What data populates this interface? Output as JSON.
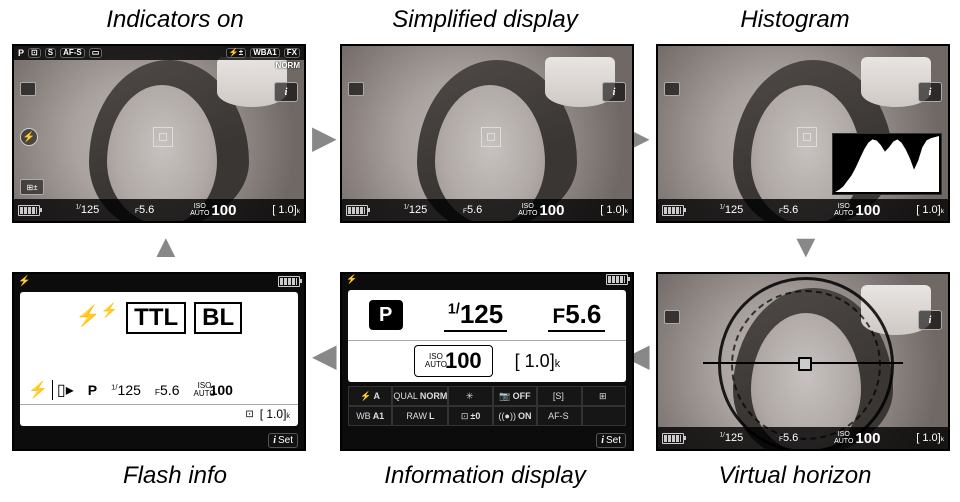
{
  "labels": {
    "indicators_on": "Indicators on",
    "simplified": "Simplified display",
    "histogram": "Histogram",
    "flash": "Flash info",
    "info": "Information display",
    "virtual": "Virtual horizon"
  },
  "common": {
    "mode": "P",
    "shutter_pre": "1/",
    "shutter_val": "125",
    "aperture_pre": "F",
    "aperture_val": "5.6",
    "iso_label_top": "ISO",
    "iso_label_bot": "AUTO",
    "iso_val": "100",
    "remaining": "[  1.0]",
    "remaining_suffix": "k",
    "i_icon": "i",
    "set_label": "Set",
    "flash_glyph": "⚡",
    "wb_label": "WB",
    "wb_a": "A",
    "wb_a1": "A1",
    "fx": "FX",
    "norm": "NORM",
    "afs": "AF-S",
    "s_icon": "S"
  },
  "flash_panel": {
    "flash_mode1": "TTL",
    "flash_mode2": "BL"
  },
  "info_panel": {
    "cells": [
      [
        "⚡",
        "A"
      ],
      [
        "QUAL",
        "NORM"
      ],
      [
        "✳",
        ""
      ],
      [
        "📷",
        "OFF"
      ],
      [
        "[S]",
        ""
      ],
      [
        "⊞",
        ""
      ],
      [
        "WB",
        "A1"
      ],
      [
        "RAW",
        "L"
      ],
      [
        "⊡",
        "±0"
      ],
      [
        "((●))",
        "ON"
      ],
      [
        "AF-S",
        ""
      ],
      [
        "",
        ""
      ]
    ]
  }
}
